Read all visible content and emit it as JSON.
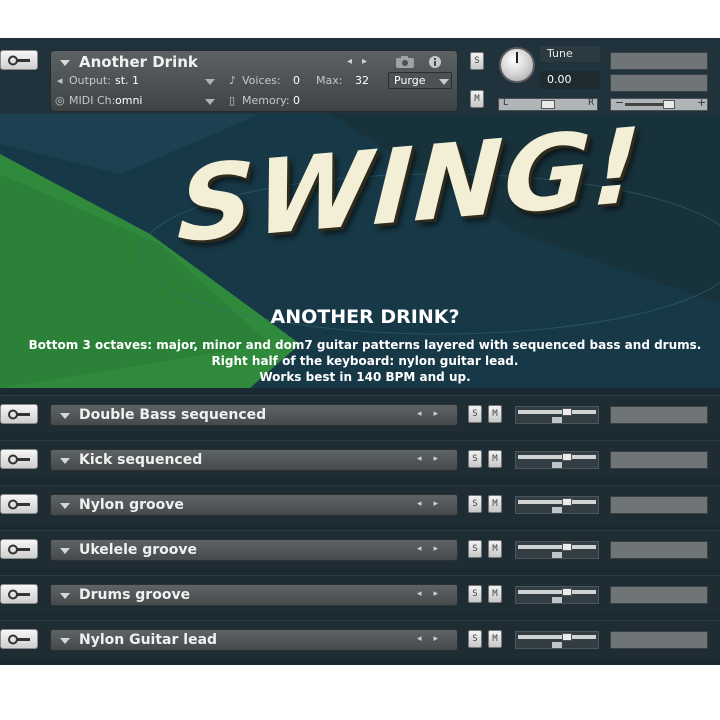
{
  "instrument": {
    "title": "Another Drink",
    "output_label": "Output:",
    "output_value": "st. 1",
    "voices_label": "Voices:",
    "voices_value": "0",
    "max_label": "Max:",
    "max_value": "32",
    "purge_label": "Purge",
    "midi_label": "MIDI Ch:",
    "midi_value": "omni",
    "memory_label": "Memory:",
    "memory_value": "0",
    "solo_label": "S",
    "mute_label": "M",
    "tune_label": "Tune",
    "tune_value": "0.00",
    "pan_left": "L",
    "pan_right": "R"
  },
  "artwork": {
    "logo_text": "SWING!",
    "heading": "ANOTHER DRINK?",
    "lines": [
      "Bottom 3 octaves: major, minor and dom7 guitar patterns layered with sequenced bass and drums.",
      "Right half of the keyboard: nylon guitar lead.",
      "Works best in 140 BPM and up."
    ]
  },
  "rows": [
    {
      "name": "Double Bass sequenced",
      "solo": "S",
      "mute": "M"
    },
    {
      "name": "Kick sequenced",
      "solo": "S",
      "mute": "M"
    },
    {
      "name": "Nylon groove",
      "solo": "S",
      "mute": "M"
    },
    {
      "name": "Ukelele groove",
      "solo": "S",
      "mute": "M"
    },
    {
      "name": "Drums groove",
      "solo": "S",
      "mute": "M"
    },
    {
      "name": "Nylon Guitar lead",
      "solo": "S",
      "mute": "M"
    }
  ],
  "colors": {
    "background": "#1a2a33",
    "accent_green": "#2f8a3c",
    "panel": "#4b5153"
  },
  "icons": {
    "settings": "wrench-icon",
    "snapshot": "camera-icon",
    "dropdown": "triangle-down-icon",
    "prev_next": "arrow-left-right-icon"
  }
}
